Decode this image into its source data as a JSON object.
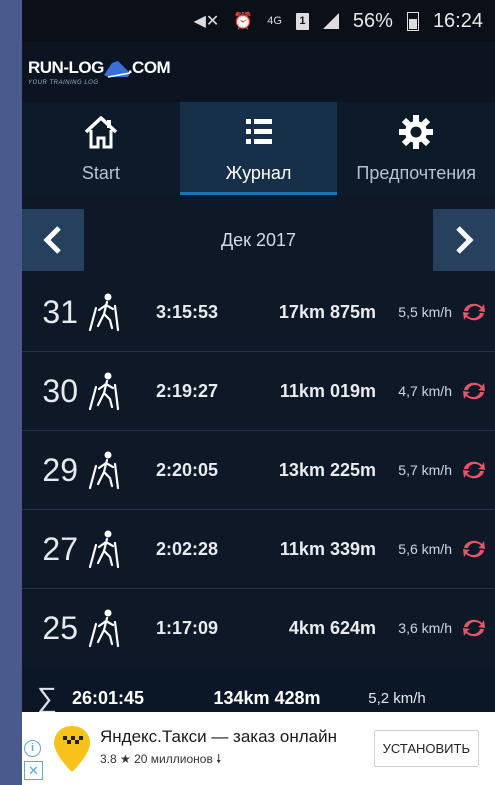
{
  "status_bar": {
    "network": "4G",
    "sim": "1",
    "battery": "56%",
    "time": "16:24"
  },
  "logo": {
    "text_left": "RUN-LOG",
    "text_right": ".COM",
    "tagline": "YOUR TRAINING LOG"
  },
  "tabs": [
    {
      "label": "Start",
      "icon": "home-icon",
      "active": false
    },
    {
      "label": "Журнал",
      "icon": "list-icon",
      "active": true
    },
    {
      "label": "Предпочтения",
      "icon": "gear-icon",
      "active": false
    }
  ],
  "month": {
    "label": "Дек 2017"
  },
  "entries": [
    {
      "day": "31",
      "time": "3:15:53",
      "distance": "17km 875m",
      "speed": "5,5 km/h"
    },
    {
      "day": "30",
      "time": "2:19:27",
      "distance": "11km 019m",
      "speed": "4,7 km/h"
    },
    {
      "day": "29",
      "time": "2:20:05",
      "distance": "13km 225m",
      "speed": "5,7 km/h"
    },
    {
      "day": "27",
      "time": "2:02:28",
      "distance": "11km 339m",
      "speed": "5,6 km/h"
    },
    {
      "day": "25",
      "time": "1:17:09",
      "distance": "4km 624m",
      "speed": "3,6 km/h"
    }
  ],
  "totals": {
    "symbol": "∑",
    "time": "26:01:45",
    "distance": "134km 428m",
    "speed": "5,2 km/h"
  },
  "ad": {
    "title": "Яндекс.Такси — заказ онлайн",
    "rating": "3.8",
    "installs": "20 миллионов",
    "button": "УСТАНОВИТЬ",
    "info": "i",
    "close": "✕"
  },
  "colors": {
    "background": "#0e1826",
    "active_tab": "#16304a",
    "accent": "#1b74b4",
    "sync": "#e8556b",
    "ad_logo": "#f7c21a"
  }
}
